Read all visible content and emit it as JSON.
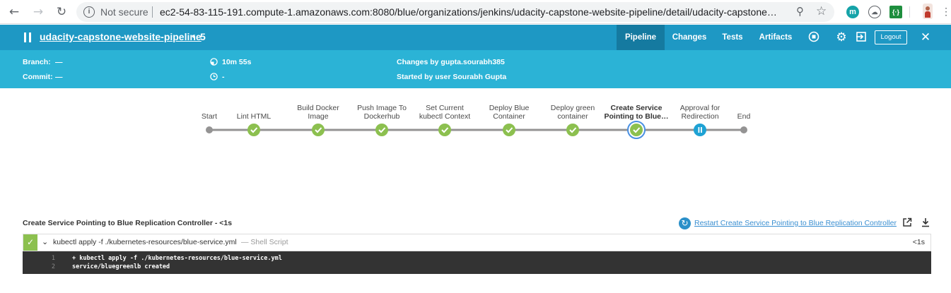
{
  "browser": {
    "security_label": "Not secure",
    "url": "ec2-54-83-115-191.compute-1.amazonaws.com:8080/blue/organizations/jenkins/udacity-capstone-website-pipeline/detail/udacity-capstone…",
    "extensions": [
      "m",
      "{·}"
    ]
  },
  "header": {
    "pipeline_name": "udacity-capstone-website-pipeline",
    "run_number": "5",
    "tabs": [
      "Pipeline",
      "Changes",
      "Tests",
      "Artifacts"
    ],
    "active_tab": "Pipeline",
    "logout_label": "Logout"
  },
  "info": {
    "branch_label": "Branch:",
    "branch_value": "—",
    "commit_label": "Commit:",
    "commit_value": "—",
    "duration": "10m 55s",
    "time_ago": "-",
    "changes": "Changes by gupta.sourabh385",
    "started_by": "Started by user Sourabh Gupta"
  },
  "colors": {
    "header_bg": "#1e98c4",
    "infobar_bg": "#2bb3d6",
    "success": "#8cc04f",
    "paused": "#1ea2d4",
    "selected_ring": "#4a90e2"
  },
  "stages": [
    {
      "label_1": "",
      "label_2": "Start",
      "status": "start"
    },
    {
      "label_1": "",
      "label_2": "Lint HTML",
      "status": "success"
    },
    {
      "label_1": "Build Docker",
      "label_2": "Image",
      "status": "success"
    },
    {
      "label_1": "Push Image To",
      "label_2": "Dockerhub",
      "status": "success"
    },
    {
      "label_1": "Set Current",
      "label_2": "kubectl Context",
      "status": "success"
    },
    {
      "label_1": "Deploy Blue",
      "label_2": "Container",
      "status": "success"
    },
    {
      "label_1": "Deploy green",
      "label_2": "container",
      "status": "success"
    },
    {
      "label_1": "Create Service",
      "label_2": "Pointing to Blue…",
      "status": "success-selected"
    },
    {
      "label_1": "Approval for",
      "label_2": "Redirection",
      "status": "paused"
    },
    {
      "label_1": "",
      "label_2": "End",
      "status": "end"
    }
  ],
  "log": {
    "title": "Create Service Pointing to Blue Replication Controller - <1s",
    "restart_label": "Restart Create Service Pointing to Blue Replication Controller",
    "step_command": "kubectl apply -f ./kubernetes-resources/blue-service.yml",
    "step_type": "— Shell Script",
    "step_duration": "<1s",
    "lines": [
      {
        "num": "1",
        "text": "+ kubectl apply -f ./kubernetes-resources/blue-service.yml"
      },
      {
        "num": "2",
        "text": "service/bluegreenlb created"
      }
    ]
  }
}
